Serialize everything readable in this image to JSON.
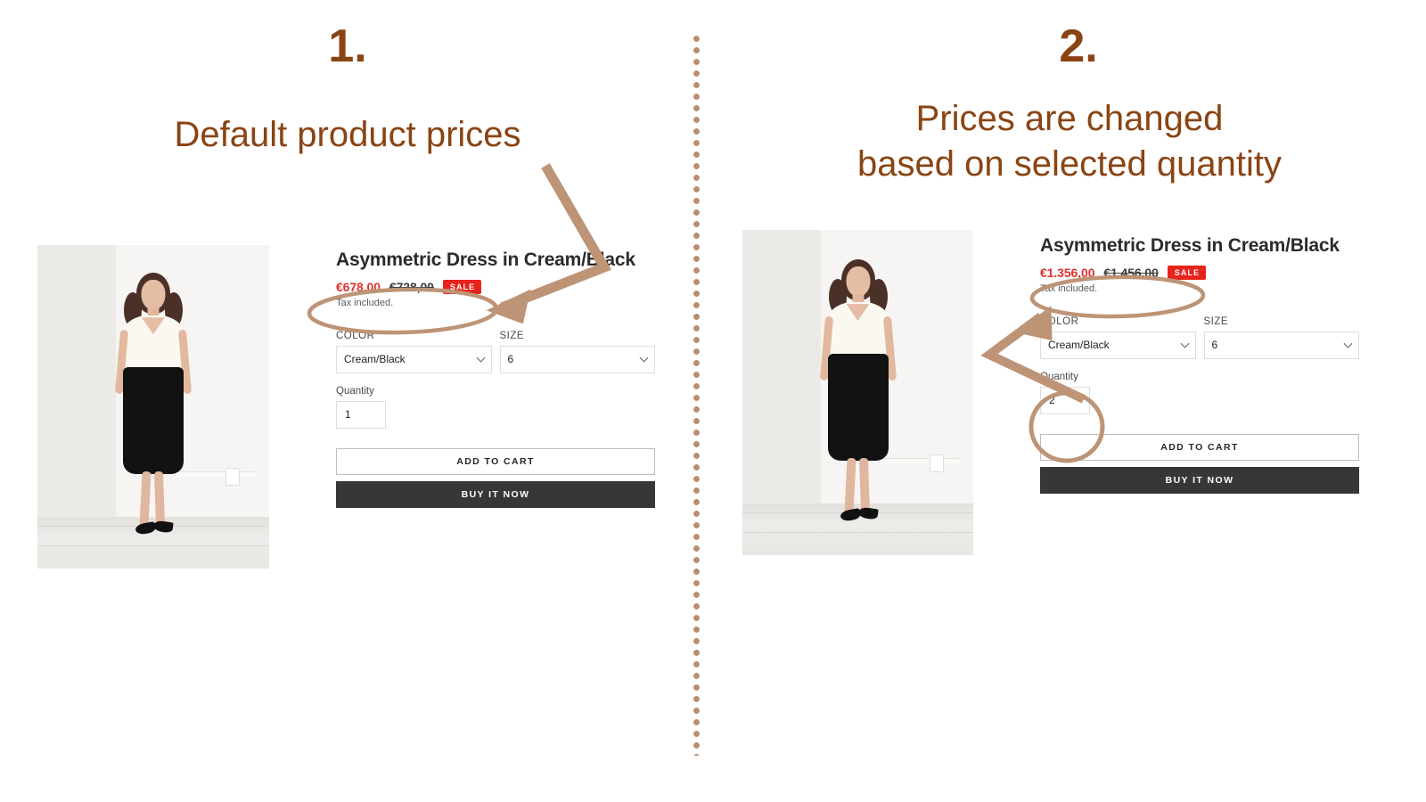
{
  "steps": [
    {
      "number": "1.",
      "caption": "Default product prices"
    },
    {
      "number": "2.",
      "caption": "Prices are changed\nbased on selected quantity"
    }
  ],
  "colors": {
    "heading": "#8a4413",
    "annotation": "#bd9476",
    "sale_price": "#e0312c",
    "sale_badge": "#e8231c",
    "buy_button": "#373737",
    "divider_dot": "#b98d6d"
  },
  "panels": [
    {
      "id": "before",
      "product": {
        "title": "Asymmetric Dress in Cream/Black",
        "sale_price": "€678,00",
        "compare_price": "€728,00",
        "badge": "SALE",
        "tax_note": "Tax included.",
        "options": [
          {
            "label": "COLOR",
            "value": "Cream/Black"
          },
          {
            "label": "SIZE",
            "value": "6"
          }
        ],
        "quantity_label": "Quantity",
        "quantity_value": "1",
        "add_to_cart_label": "ADD TO CART",
        "buy_now_label": "BUY IT NOW"
      }
    },
    {
      "id": "after",
      "product": {
        "title": "Asymmetric Dress in Cream/Black",
        "sale_price": "€1.356,00",
        "compare_price": "€1.456,00",
        "badge": "SALE",
        "tax_note": "Tax included.",
        "options": [
          {
            "label": "COLOR",
            "value": "Cream/Black"
          },
          {
            "label": "SIZE",
            "value": "6"
          }
        ],
        "quantity_label": "Quantity",
        "quantity_value": "2",
        "add_to_cart_label": "ADD TO CART",
        "buy_now_label": "BUY IT NOW"
      }
    }
  ]
}
